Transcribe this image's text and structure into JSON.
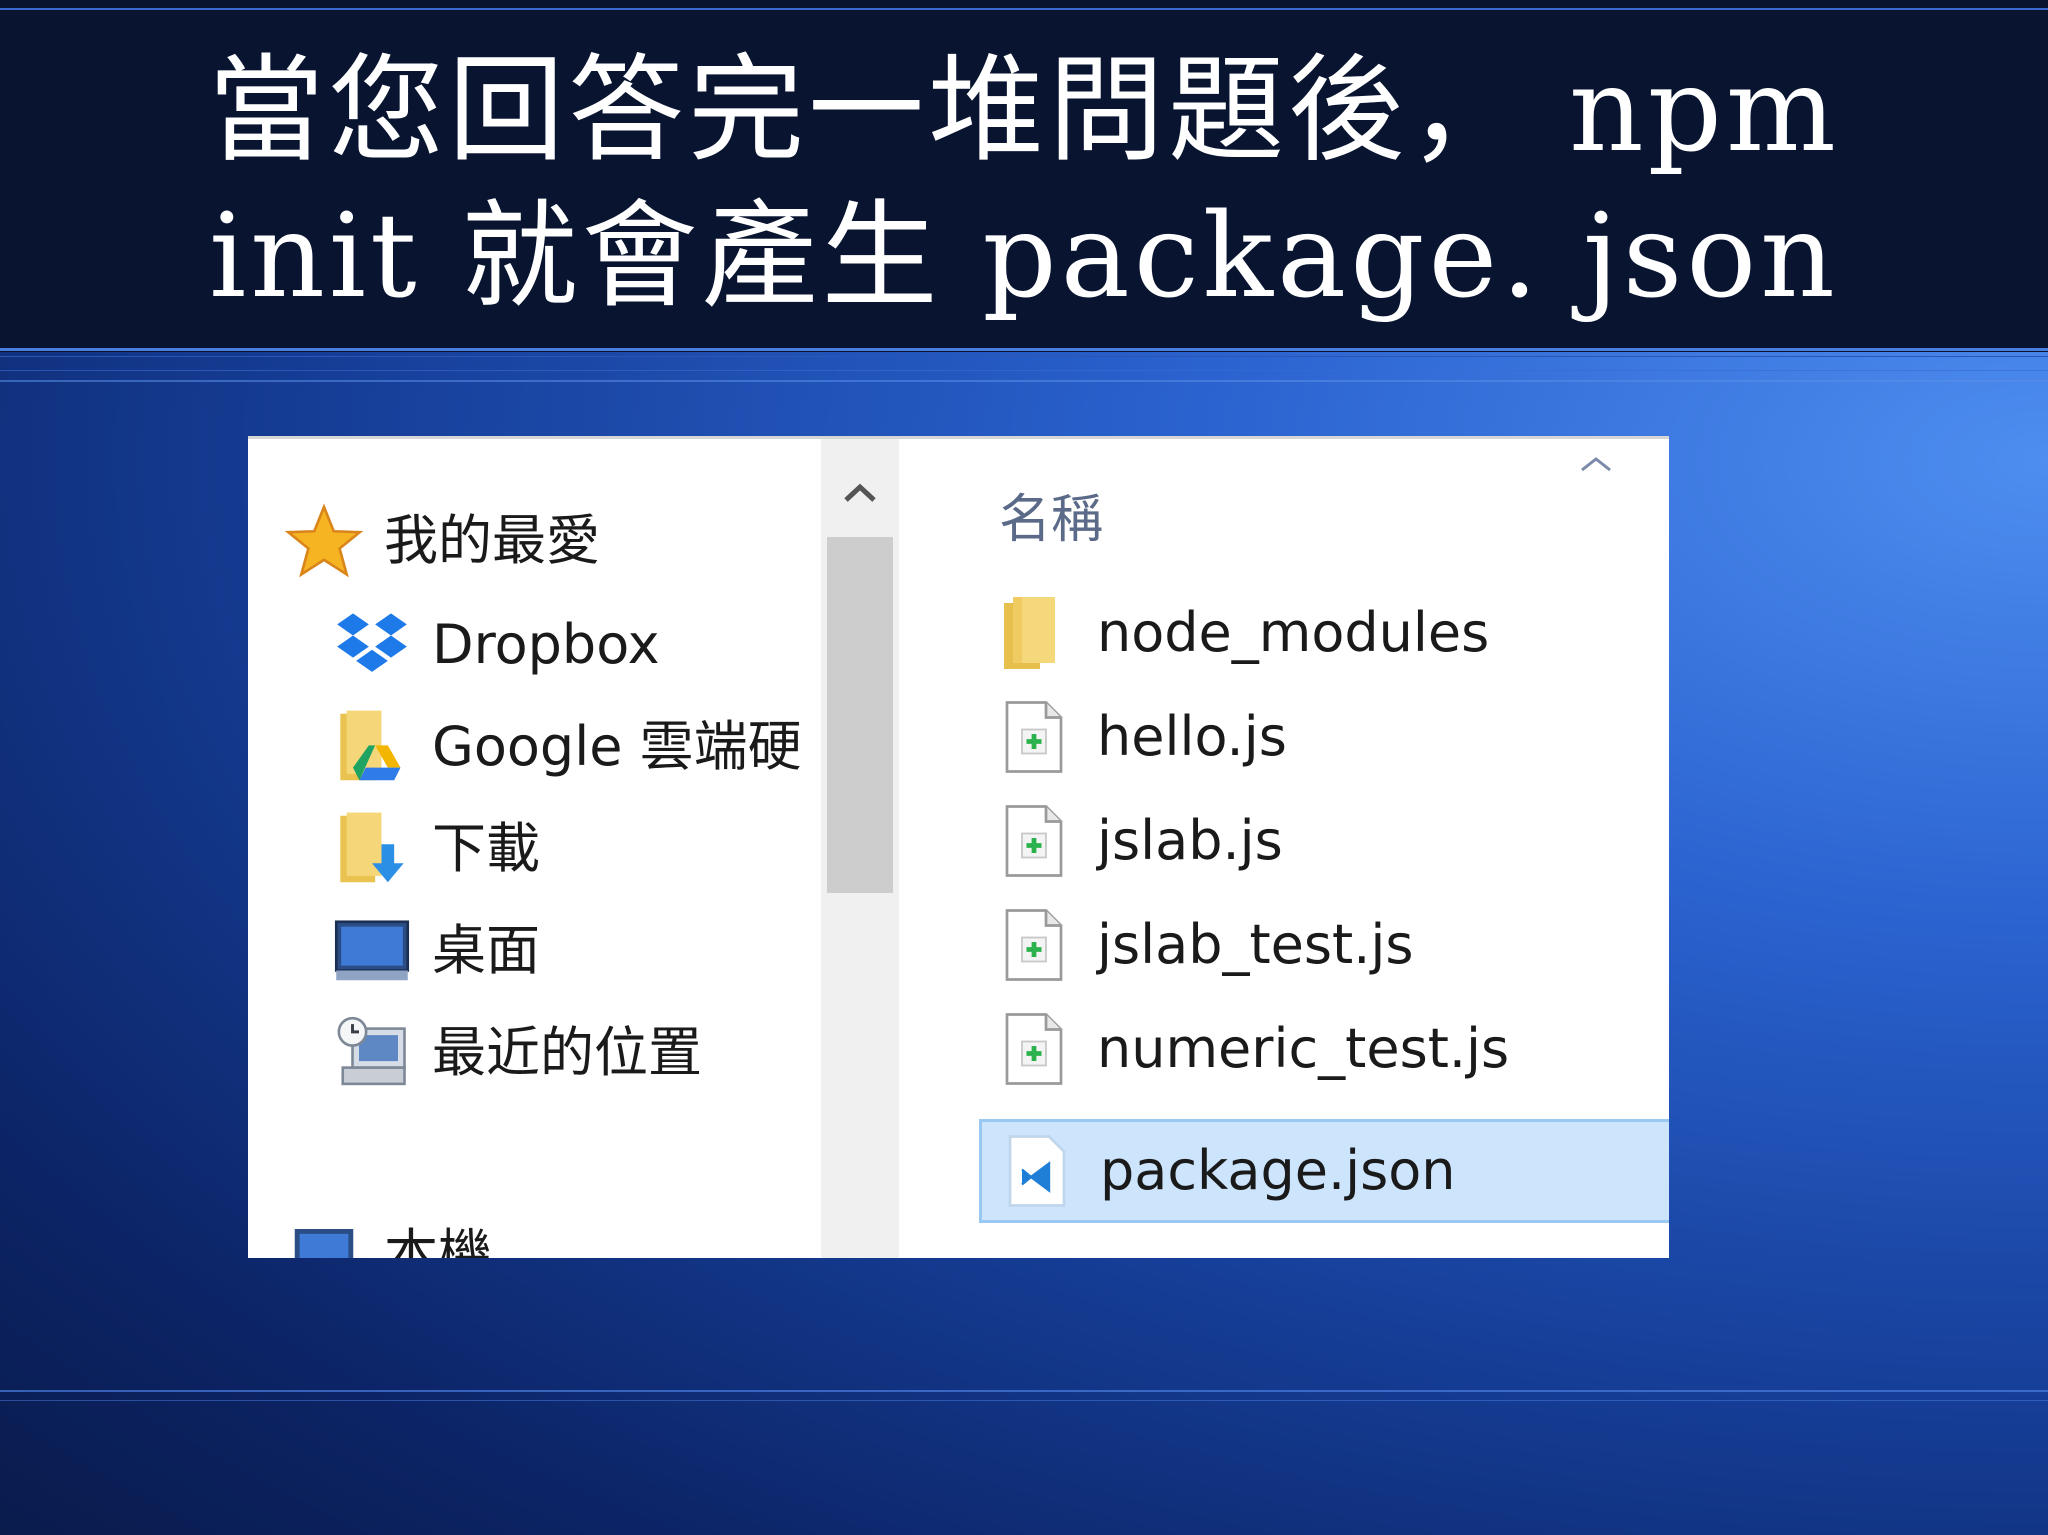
{
  "slide": {
    "title_line1": "當您回答完一堆問題後， npm",
    "title_line2": "init  就會產生 package. json"
  },
  "explorer": {
    "nav": {
      "favorites_label": "我的最愛",
      "items": [
        {
          "label": "Dropbox",
          "icon": "dropbox-icon"
        },
        {
          "label": "Google 雲端硬",
          "icon": "google-drive-folder-icon"
        },
        {
          "label": "下載",
          "icon": "downloads-folder-icon"
        },
        {
          "label": "桌面",
          "icon": "desktop-icon"
        },
        {
          "label": "最近的位置",
          "icon": "recent-places-icon"
        }
      ],
      "partial_item_label": "本機"
    },
    "column_header": "名稱",
    "files": [
      {
        "name": "node_modules",
        "type": "folder"
      },
      {
        "name": "hello.js",
        "type": "js-file"
      },
      {
        "name": "jslab.js",
        "type": "js-file"
      },
      {
        "name": "jslab_test.js",
        "type": "js-file"
      },
      {
        "name": "numeric_test.js",
        "type": "js-file"
      },
      {
        "name": "package.json",
        "type": "json-file",
        "selected": true
      }
    ]
  },
  "colors": {
    "title_band": "#081430",
    "selection": "#cce4fc",
    "selection_border": "#99c9f3"
  }
}
